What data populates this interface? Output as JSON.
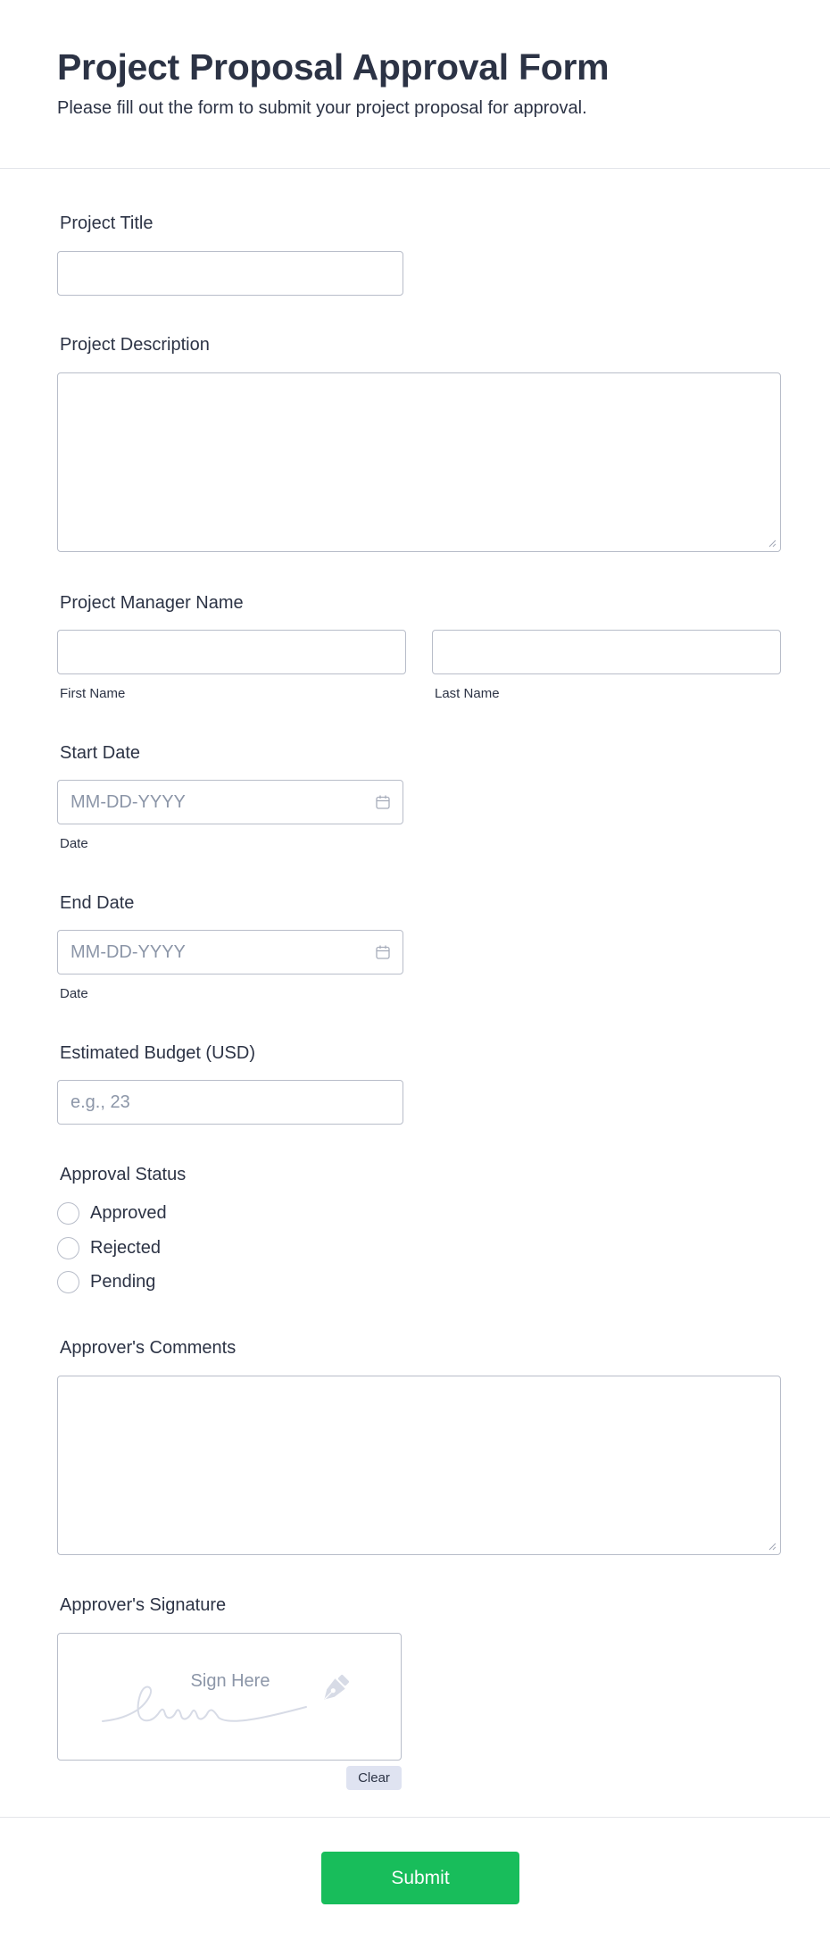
{
  "header": {
    "title": "Project Proposal Approval Form",
    "subtitle": "Please fill out the form to submit your project proposal for approval."
  },
  "fields": {
    "project_title": {
      "label": "Project Title",
      "value": ""
    },
    "project_description": {
      "label": "Project Description",
      "value": ""
    },
    "project_manager": {
      "label": "Project Manager Name",
      "first_name_sublabel": "First Name",
      "last_name_sublabel": "Last Name"
    },
    "start_date": {
      "label": "Start Date",
      "placeholder": "MM-DD-YYYY",
      "sublabel": "Date"
    },
    "end_date": {
      "label": "End Date",
      "placeholder": "MM-DD-YYYY",
      "sublabel": "Date"
    },
    "budget": {
      "label": "Estimated Budget (USD)",
      "placeholder": "e.g., 23"
    },
    "approval_status": {
      "label": "Approval Status",
      "options": [
        "Approved",
        "Rejected",
        "Pending"
      ]
    },
    "comments": {
      "label": "Approver's Comments",
      "value": ""
    },
    "signature": {
      "label": "Approver's Signature",
      "prompt": "Sign Here",
      "clear_label": "Clear"
    }
  },
  "submit_label": "Submit",
  "colors": {
    "accent": "#18bd5b",
    "text": "#2c3345",
    "border": "#b8bdc9",
    "placeholder": "#8c96a8"
  }
}
